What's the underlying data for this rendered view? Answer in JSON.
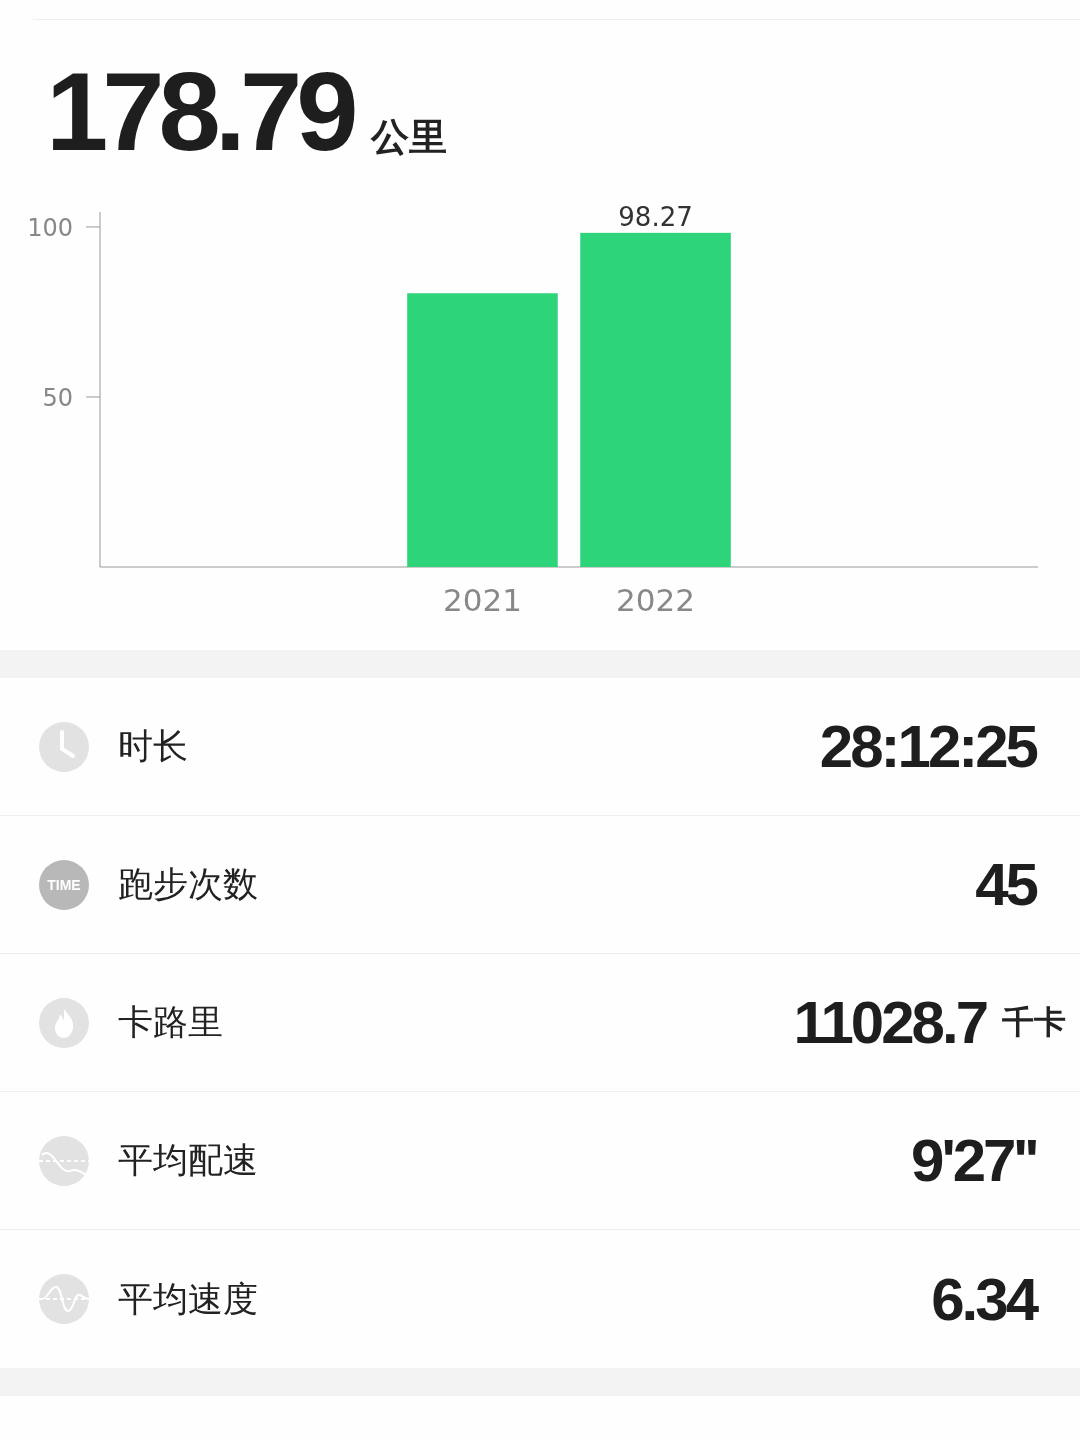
{
  "total": {
    "value": "178.79",
    "unit": "公里"
  },
  "chart": {
    "chart_data": {
      "type": "bar",
      "categories": [
        "2021",
        "2022"
      ],
      "series": [
        {
          "color": "#2ed47a",
          "values": [
            80.5,
            98.27
          ]
        }
      ],
      "ylim": [
        0,
        104.4
      ],
      "yticks": [
        50,
        100
      ],
      "annotations": [
        "98.27"
      ]
    }
  },
  "stats": [
    {
      "kind": "clock",
      "label": "时长",
      "value": "28:12:25"
    },
    {
      "kind": "badge",
      "badge": "TIME",
      "label": "跑步次数",
      "value": "45"
    },
    {
      "kind": "flame",
      "label": "卡路里",
      "value": "11028.7",
      "unit": "千卡"
    },
    {
      "kind": "pace",
      "label": "平均配速",
      "value": "9'27''"
    },
    {
      "kind": "speed",
      "label": "平均速度",
      "value": "6.34"
    }
  ]
}
